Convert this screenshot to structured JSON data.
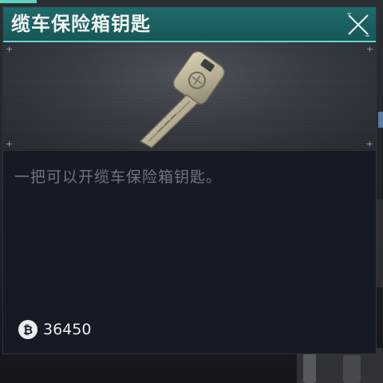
{
  "item": {
    "title": "缆车保险箱钥匙",
    "description": "一把可以开缆车保险箱钥匙。",
    "price": "36450"
  },
  "icons": {
    "close": "close-icon",
    "currency": "bitcoin-coin-icon",
    "item_image": "key-icon"
  },
  "colors": {
    "title_bar": "#1f6a6a",
    "accent_line": "#63d6c8",
    "panel_bg": "#151a24",
    "description_text": "#6f7680"
  }
}
